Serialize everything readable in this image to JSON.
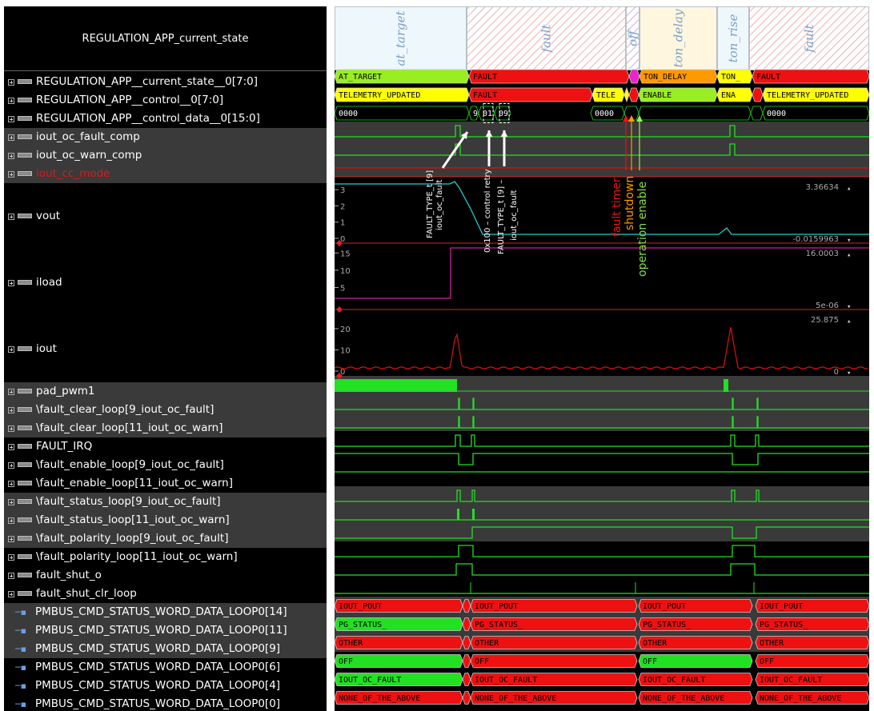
{
  "header": {
    "title": "REGULATION_APP_current_state"
  },
  "phases": [
    "at_target",
    "fault",
    "off",
    "ton_delay",
    "ton_rise",
    "fault"
  ],
  "signals": [
    {
      "name": "REGULATION_APP__current_state__0[7:0]",
      "type": "bus",
      "bg": "black"
    },
    {
      "name": "REGULATION_APP__control__0[7:0]",
      "type": "bus",
      "bg": "black"
    },
    {
      "name": "REGULATION_APP__control_data__0[15:0]",
      "type": "bus",
      "bg": "black"
    },
    {
      "name": "iout_oc_fault_comp",
      "type": "bus",
      "bg": "gray"
    },
    {
      "name": "iout_oc_warn_comp",
      "type": "bus",
      "bg": "gray"
    },
    {
      "name": "iout_cc_mode",
      "type": "bus",
      "bg": "gray",
      "color": "#e01818"
    },
    {
      "name": "vout",
      "type": "bus",
      "bg": "black"
    },
    {
      "name": "iload",
      "type": "bus",
      "bg": "black"
    },
    {
      "name": "iout",
      "type": "bus",
      "bg": "black"
    },
    {
      "name": "pad_pwm1",
      "type": "bus",
      "bg": "gray"
    },
    {
      "name": "\\fault_clear_loop[9_iout_oc_fault]",
      "type": "bus",
      "bg": "gray"
    },
    {
      "name": "\\fault_clear_loop[11_iout_oc_warn]",
      "type": "bus",
      "bg": "gray"
    },
    {
      "name": "FAULT_IRQ",
      "type": "bus",
      "bg": "black"
    },
    {
      "name": "\\fault_enable_loop[9_iout_oc_fault]",
      "type": "bus",
      "bg": "black"
    },
    {
      "name": "\\fault_enable_loop[11_iout_oc_warn]",
      "type": "bus",
      "bg": "black"
    },
    {
      "name": "\\fault_status_loop[9_iout_oc_fault]",
      "type": "bus",
      "bg": "gray"
    },
    {
      "name": "\\fault_status_loop[11_iout_oc_warn]",
      "type": "bus",
      "bg": "gray"
    },
    {
      "name": "\\fault_polarity_loop[9_iout_oc_fault]",
      "type": "bus",
      "bg": "gray"
    },
    {
      "name": "\\fault_polarity_loop[11_iout_oc_warn]",
      "type": "bus",
      "bg": "black"
    },
    {
      "name": "fault_shut_o",
      "type": "bus",
      "bg": "black"
    },
    {
      "name": "fault_shut_clr_loop",
      "type": "bus",
      "bg": "black"
    },
    {
      "name": "PMBUS_CMD_STATUS_WORD_DATA_LOOP0[14]",
      "type": "pm",
      "bg": "gray"
    },
    {
      "name": "PMBUS_CMD_STATUS_WORD_DATA_LOOP0[11]",
      "type": "pm",
      "bg": "gray"
    },
    {
      "name": "PMBUS_CMD_STATUS_WORD_DATA_LOOP0[9]",
      "type": "pm",
      "bg": "gray"
    },
    {
      "name": "PMBUS_CMD_STATUS_WORD_DATA_LOOP0[6]",
      "type": "pm",
      "bg": "black"
    },
    {
      "name": "PMBUS_CMD_STATUS_WORD_DATA_LOOP0[4]",
      "type": "pm",
      "bg": "black"
    },
    {
      "name": "PMBUS_CMD_STATUS_WORD_DATA_LOOP0[0]",
      "type": "pm",
      "bg": "black"
    }
  ],
  "state_values": [
    "AT_TARGET",
    "FAULT",
    "TON_DELAY",
    "TON_",
    "FAULT"
  ],
  "control_values": [
    "TELEMETRY_UPDATED",
    "FAULT",
    "TELE",
    "ENABLE",
    "ENA",
    "TELEMETRY_UPDATED"
  ],
  "control_data_values": [
    "0000",
    "9",
    "01",
    "09",
    "0000",
    "0000"
  ],
  "analog": {
    "vout": {
      "top_label": "3.36634",
      "bottom_label": "-0.0159963",
      "ticks": [
        "3",
        "2",
        "1",
        "0"
      ]
    },
    "iload": {
      "top_label": "16.0003",
      "bottom_label": "5e-06",
      "ticks": [
        "15",
        "10",
        "5"
      ]
    },
    "iout": {
      "top_label": "25.875",
      "bottom_label": "0",
      "ticks": [
        "20",
        "10",
        "0"
      ]
    }
  },
  "annotations": {
    "a1_line1": "FAULT_TYPE_t [9]",
    "a1_line2": "iout_oc_fault",
    "a2": "0x100 – control retry",
    "a3_line1": "FAULT_TYPE_t [9] –",
    "a3_line2": "iout_oc_fault",
    "fault_timer": "fault timer",
    "shutdown": "shutdown",
    "operation_enable": "operation enable"
  },
  "pmbus_values": [
    [
      "IOUT_POUT",
      "IOUT_POUT",
      "IOUT_POUT",
      "IOUT_POUT"
    ],
    [
      "PG_STATUS_",
      "PG_STATUS_",
      "PG_STATUS_",
      "PG_STATUS_"
    ],
    [
      "OTHER",
      "OTHER",
      "OTHER",
      "OTHER"
    ],
    [
      "OFF",
      "OFF",
      "OFF",
      "OFF"
    ],
    [
      "IOUT_OC_FAULT",
      "IOUT_OC_FAULT",
      "IOUT_OC_FAULT",
      "IOUT_OC_FAULT"
    ],
    [
      "NONE_OF_THE_ABOVE",
      "NONE_OF_THE_ABOVE",
      "NONE_OF_THE_ABOVE",
      "NONE_OF_THE_ABOVE"
    ]
  ],
  "colors": {
    "green": "#22e022",
    "red": "#ee1111",
    "yellow": "#ffff00",
    "lime": "#99ee22",
    "orange": "#ff9900",
    "cyan": "#22cccc",
    "magenta": "#cc2299",
    "trace_red": "#dd1111"
  }
}
